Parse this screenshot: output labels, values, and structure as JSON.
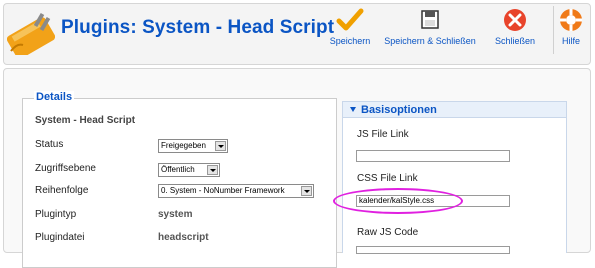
{
  "toolbar": {
    "title": "Plugins: System - Head Script",
    "buttons": [
      {
        "label": "Speichern",
        "icon": "checkmark-icon"
      },
      {
        "label": "Speichern & Schließen",
        "icon": "save-close-icon"
      },
      {
        "label": "Schließen",
        "icon": "close-icon"
      },
      {
        "label": "Hilfe",
        "icon": "help-icon"
      }
    ]
  },
  "details": {
    "legend": "Details",
    "plugin_name": "System - Head Script",
    "rows": [
      {
        "label": "Status",
        "value": "Freigegeben"
      },
      {
        "label": "Zugriffsebene",
        "value": "Öffentlich"
      },
      {
        "label": "Reihenfolge",
        "value": "0. System - NoNumber Framework"
      },
      {
        "label": "Plugintyp",
        "value": "system"
      },
      {
        "label": "Plugindatei",
        "value": "headscript"
      }
    ]
  },
  "basic_options": {
    "title": "Basisoptionen",
    "fields": [
      {
        "label": "JS File Link",
        "value": ""
      },
      {
        "label": "CSS File Link",
        "value": "kalender/kalStyle.css"
      },
      {
        "label": "Raw JS Code",
        "value": ""
      }
    ]
  },
  "colors": {
    "accent": "#0b55c4",
    "highlight": "#e020e0",
    "check": "#f0a000",
    "close": "#e8442b"
  }
}
